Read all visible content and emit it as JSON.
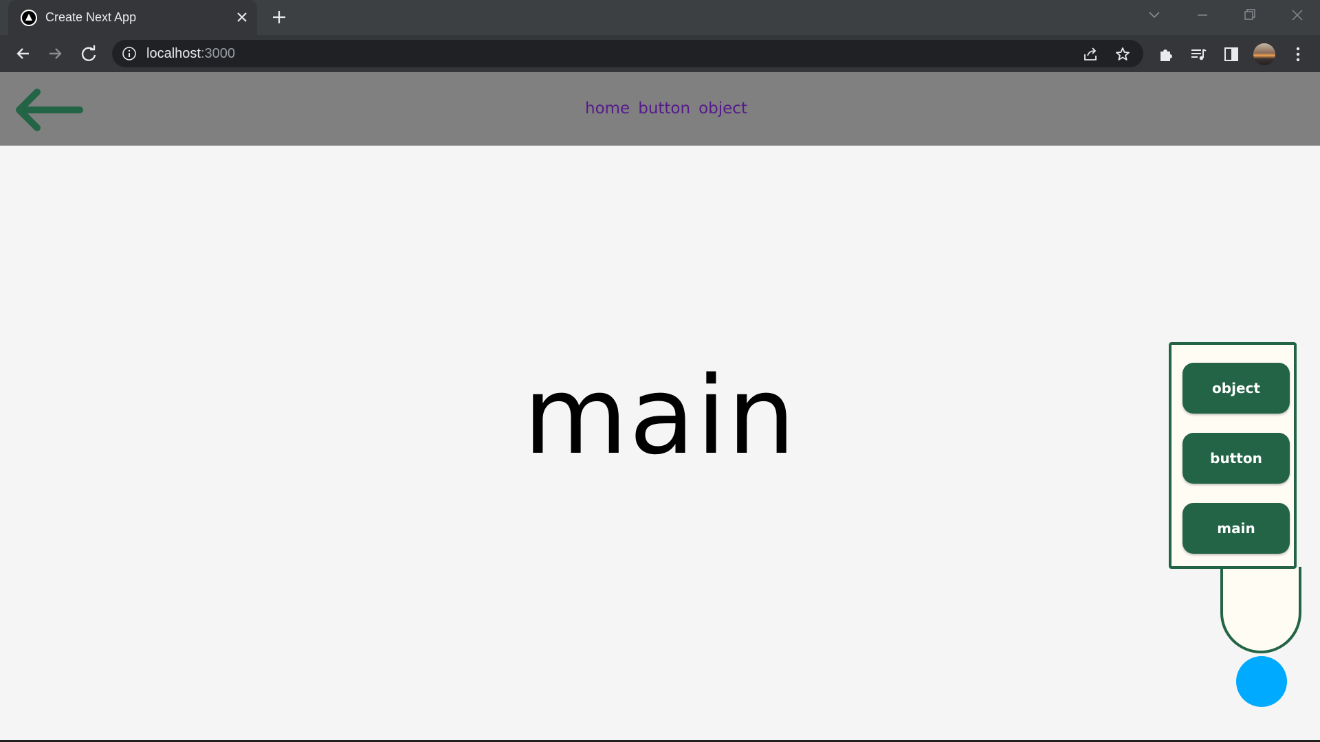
{
  "browser": {
    "tab_title": "Create Next App",
    "url_host": "localhost",
    "url_port": ":3000"
  },
  "app": {
    "nav_links": [
      "home",
      "button",
      "object"
    ],
    "main_title": "main",
    "panel_buttons": [
      "object",
      "button",
      "main"
    ]
  },
  "colors": {
    "accent_green": "#236446",
    "link_purple": "#551a8b",
    "toggle_blue": "#00aaff",
    "header_gray": "#808080"
  },
  "icons": {
    "tab": [
      "nextjs-favicon-icon",
      "close-icon",
      "plus-icon"
    ],
    "toolbar": [
      "back-icon",
      "forward-icon",
      "reload-icon",
      "info-icon",
      "share-icon",
      "star-icon",
      "puzzle-icon",
      "media-icon",
      "sidepanel-icon",
      "kebab-menu-icon"
    ],
    "page": [
      "arrow-left-icon"
    ]
  }
}
